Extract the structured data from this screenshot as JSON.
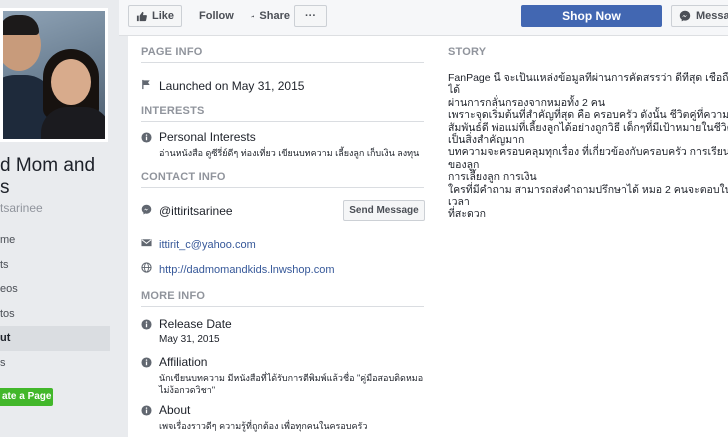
{
  "profile": {
    "name_line1": "d Mom and",
    "name_line2": "s",
    "handle": "tsarinee"
  },
  "sidebar": {
    "items": [
      {
        "label": "me"
      },
      {
        "label": "ts"
      },
      {
        "label": "eos"
      },
      {
        "label": "tos"
      },
      {
        "label": "ut"
      },
      {
        "label": "s"
      }
    ],
    "create_page": "ate a Page"
  },
  "actions": {
    "like": "Like",
    "follow": "Follow",
    "share": "Share",
    "more": "···",
    "shop_now": "Shop Now",
    "message": "Messag"
  },
  "page_info": {
    "heading": "PAGE INFO",
    "launched": "Launched on May 31, 2015"
  },
  "interests": {
    "heading": "INTERESTS",
    "title": "Personal Interests",
    "value": "อ่านหนังสือ ดูซีรี่ย์ดีๆ ท่องเที่ยว เขียนบทความ เลี้ยงลูก เก็บเงิน ลงทุน"
  },
  "contact": {
    "heading": "CONTACT INFO",
    "messenger": "@ittiritsarinee",
    "send_message": "Send Message",
    "email": "ittirit_c@yahoo.com",
    "website": "http://dadmomandkids.lnwshop.com"
  },
  "more_info": {
    "heading": "MORE INFO",
    "release_title": "Release Date",
    "release_value": "May 31, 2015",
    "affiliation_title": "Affiliation",
    "affiliation_value": "นักเขียนบทความ มีหนังสือที่ได้รับการตีพิมพ์แล้วชื่อ \"คู่มือสอบติดหมอ ไม่ง้อกวดวิชา\"",
    "about_title": "About",
    "about_value": "เพจเรื่องราวดีๆ ความรู้ที่ถูกต้อง เพื่อทุกคนในครอบครัว"
  },
  "story": {
    "heading": "STORY",
    "text": "FanPage นี้ จะเป็นแหล่งข้อมูลที่ผ่านการคัดสรรว่า ดีที่สุด เชื่อถือได้\nผ่านการกลั่นกรองจากหมอทั้ง 2 คน\nเพราะจุดเริ่มต้นที่สำคัญที่สุด คือ ครอบครัว ดังนั้น ชีวิตคู่ที่ความ\nสัมพันธ์ดี พ่อแม่ที่เลี้ยงลูกได้อย่างถูกวิธี เด็กๆที่มีเป้าหมายในชีวิต\nเป็นสิ่งสำคัญมาก\nบทความจะครอบคลุมทุกเรื่อง ที่เกี่ยวข้องกับครอบครัว การเรียนของลูก\nการเลี้ยงลูก การเงิน\nใครที่มีคำถาม สามารถส่งคำถามปรึกษาได้ หมอ 2 คนจะตอบในเวลา\nที่สะดวก"
  },
  "colors": {
    "brand": "#4267b2",
    "link": "#365899",
    "green": "#42b72a"
  }
}
